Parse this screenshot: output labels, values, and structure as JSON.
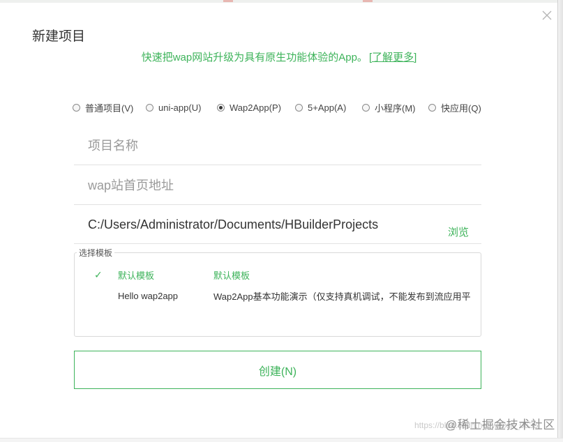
{
  "dialog": {
    "title": "新建项目",
    "subtitle": "快速把wap网站升级为具有原生功能体验的App。",
    "learn_more": "[了解更多]"
  },
  "project_types": [
    {
      "label": "普通项目(V)",
      "checked": false
    },
    {
      "label": "uni-app(U)",
      "checked": false
    },
    {
      "label": "Wap2App(P)",
      "checked": true
    },
    {
      "label": "5+App(A)",
      "checked": false
    },
    {
      "label": "小程序(M)",
      "checked": false
    },
    {
      "label": "快应用(Q)",
      "checked": false
    }
  ],
  "fields": {
    "project_name_placeholder": "项目名称",
    "wap_url_placeholder": "wap站首页地址",
    "location_value": "C:/Users/Administrator/Documents/HBuilderProjects",
    "browse_label": "浏览"
  },
  "templates": {
    "legend": "选择模板",
    "items": [
      {
        "name": "默认模板",
        "description": "默认模板",
        "selected": true,
        "check": "✓"
      },
      {
        "name": "Hello wap2app",
        "description": "Wap2App基本功能演示（仅支持真机调试，不能发布到流应用平",
        "selected": false,
        "check": ""
      }
    ]
  },
  "create_label": "创建(N)",
  "watermark": {
    "url": "https://blog.csdn.net/weixin_0635",
    "brand": "@稀土掘金技术社区"
  },
  "colors": {
    "accent": "#3db35a",
    "text": "#333333",
    "border": "#e2e2e2"
  }
}
